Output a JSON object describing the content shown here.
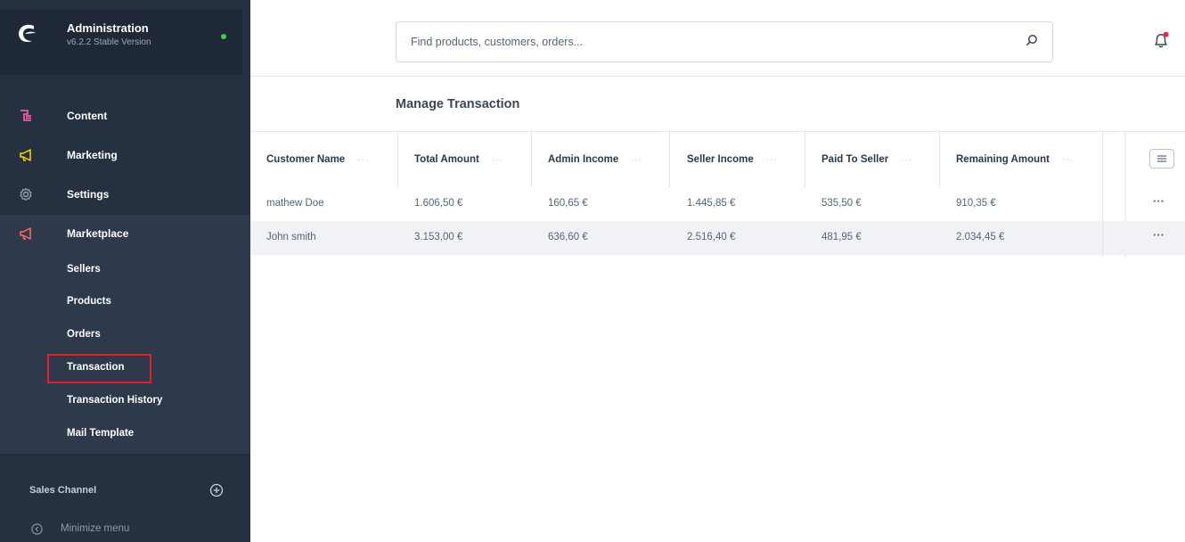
{
  "app": {
    "title": "Administration",
    "version": "v6.2.2 Stable Version",
    "status_color": "#37d046"
  },
  "sidebar": {
    "items": [
      {
        "label": "Content",
        "icon": "content-icon",
        "color": "#ff68b4"
      },
      {
        "label": "Marketing",
        "icon": "megaphone-icon",
        "color": "#ffd700"
      },
      {
        "label": "Settings",
        "icon": "gear-icon",
        "color": "#9aa8b5"
      },
      {
        "label": "Marketplace",
        "icon": "megaphone-icon",
        "color": "#ff6b5b"
      }
    ],
    "marketplace_subitems": [
      "Sellers",
      "Products",
      "Orders",
      "Transaction",
      "Transaction History",
      "Mail Template"
    ],
    "highlighted_item": "Transaction",
    "sales_channel_label": "Sales Channel",
    "minimize_label": "Minimize menu"
  },
  "search": {
    "placeholder": "Find products, customers, orders..."
  },
  "page": {
    "title": "Manage Transaction"
  },
  "table": {
    "columns": [
      "Customer Name",
      "Total Amount",
      "Admin Income",
      "Seller Income",
      "Paid To Seller",
      "Remaining Amount"
    ],
    "column_menu_glyph": "···",
    "row_action_glyph": "···",
    "rows": [
      [
        "mathew Doe",
        "1.606,50 €",
        "160,65 €",
        "1.445,85 €",
        "535,50 €",
        "910,35 €"
      ],
      [
        "John smith",
        "3.153,00 €",
        "636,60 €",
        "2.516,40 €",
        "481,95 €",
        "2.034,45 €"
      ]
    ]
  }
}
